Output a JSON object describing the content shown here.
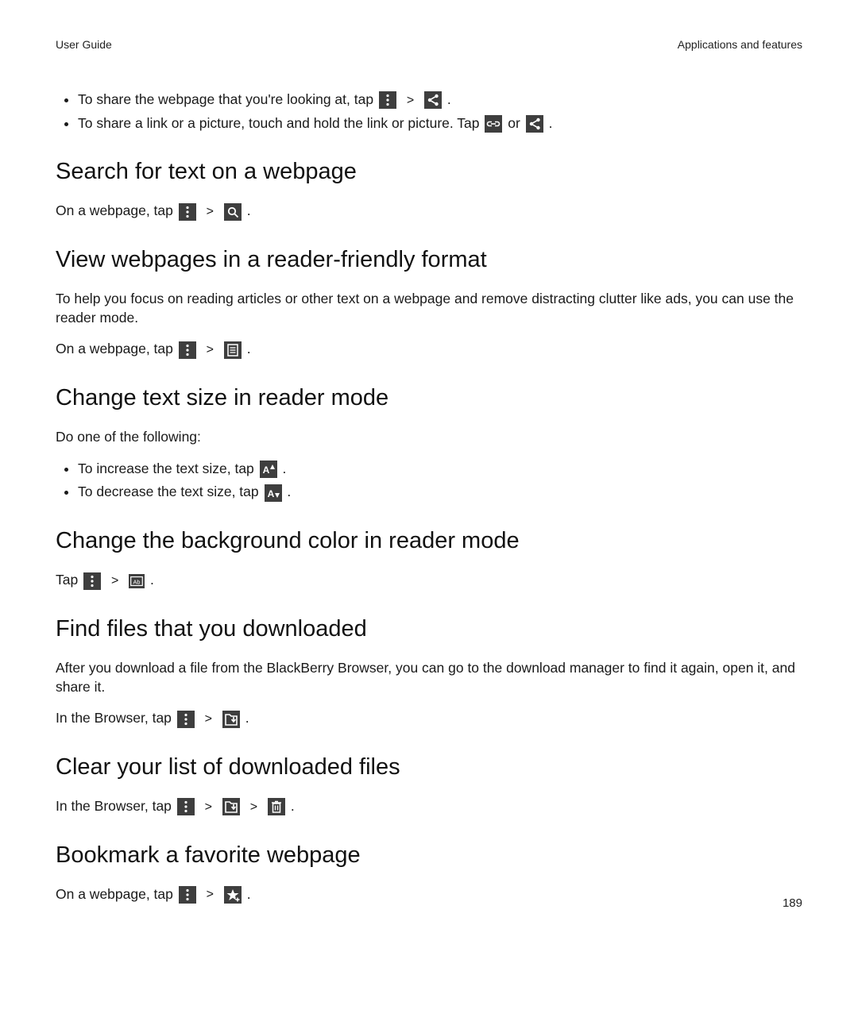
{
  "header": {
    "left": "User Guide",
    "right": "Applications and features"
  },
  "intro_bullets": {
    "b1a": "To share the webpage that you're looking at, tap ",
    "b1b": ".",
    "b2a": "To share a link or a picture, touch and hold the link or picture. Tap ",
    "b2_or": " or ",
    "b2b": "."
  },
  "sep": ">",
  "sections": {
    "search": {
      "title": "Search for text on a webpage",
      "step_a": "On a webpage, tap ",
      "step_b": "."
    },
    "reader": {
      "title": "View webpages in a reader-friendly format",
      "desc": "To help you focus on reading articles or other text on a webpage and remove distracting clutter like ads, you can use the reader mode.",
      "step_a": "On a webpage, tap ",
      "step_b": "."
    },
    "textsize": {
      "title": "Change text size in reader mode",
      "desc": "Do one of the following:",
      "inc_a": "To increase the text size, tap ",
      "inc_b": ".",
      "dec_a": "To decrease the text size, tap ",
      "dec_b": "."
    },
    "bgcolor": {
      "title": "Change the background color in reader mode",
      "step_a": "Tap ",
      "step_b": "."
    },
    "findfiles": {
      "title": "Find files that you downloaded",
      "desc": "After you download a file from the BlackBerry Browser, you can go to the download manager to find it again, open it, and share it.",
      "step_a": "In the Browser, tap ",
      "step_b": "."
    },
    "clearfiles": {
      "title": "Clear your list of downloaded files",
      "step_a": "In the Browser, tap ",
      "step_b": "."
    },
    "bookmark": {
      "title": "Bookmark a favorite webpage",
      "step_a": "On a webpage, tap ",
      "step_b": "."
    }
  },
  "page_number": "189"
}
